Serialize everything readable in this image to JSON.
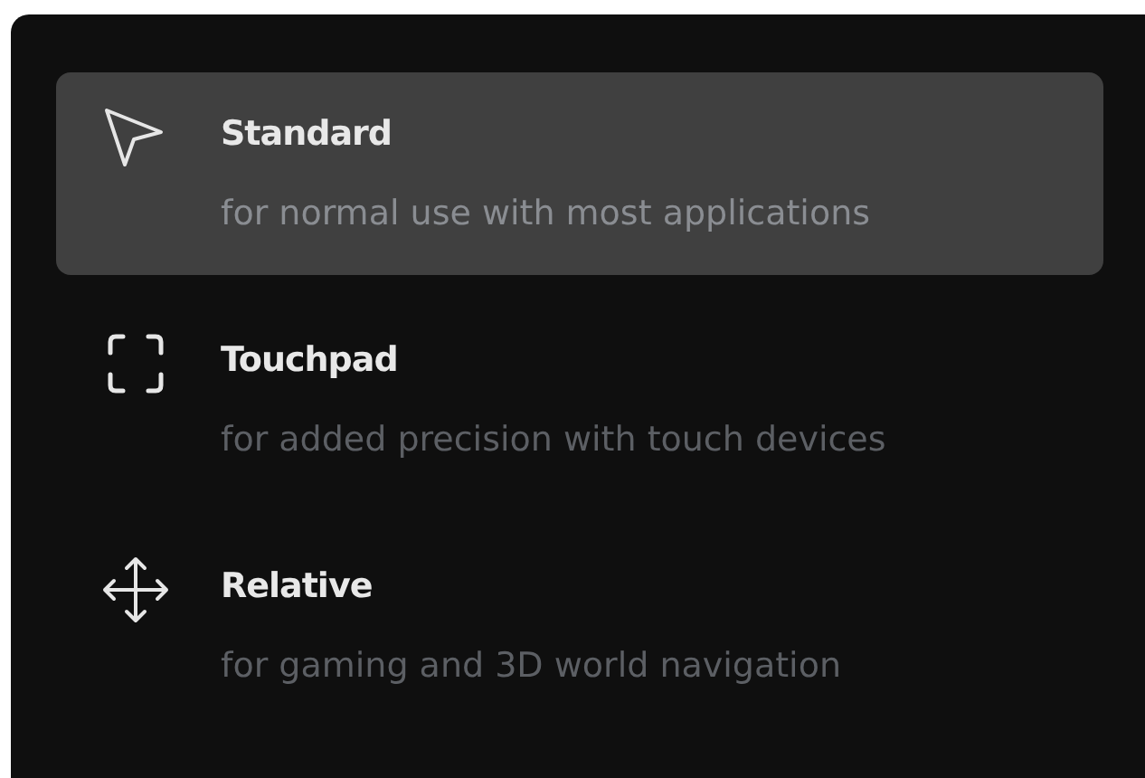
{
  "options": [
    {
      "kind": "pointer",
      "title": "Standard",
      "description": "for normal use with most applications",
      "selected": true
    },
    {
      "kind": "frame",
      "title": "Touchpad",
      "description": "for added precision with touch devices",
      "selected": false
    },
    {
      "kind": "move",
      "title": "Relative",
      "description": "for gaming and 3D world navigation",
      "selected": false
    }
  ]
}
